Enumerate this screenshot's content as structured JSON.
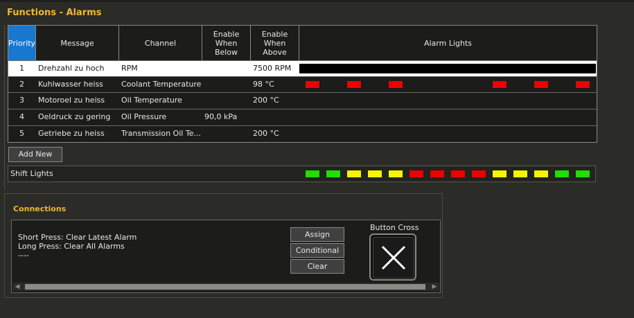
{
  "page_title": "Functions - Alarms",
  "table": {
    "headers": {
      "priority": "Priority",
      "message": "Message",
      "channel": "Channel",
      "below": "Enable When Below",
      "above": "Enable When Above",
      "lights": "Alarm Lights"
    },
    "rows": [
      {
        "priority": "1",
        "message": "Drehzahl zu hoch",
        "channel": "RPM",
        "below": "",
        "above": "7500 RPM",
        "selected": true
      },
      {
        "priority": "2",
        "message": "Kuhlwasser heiss",
        "channel": "Coolant Temperature",
        "below": "",
        "above": "98 °C",
        "lamps": [
          "red",
          "",
          "red",
          "",
          "red",
          "",
          "",
          "",
          "",
          "red",
          "",
          "red",
          "",
          "red"
        ]
      },
      {
        "priority": "3",
        "message": "Motoroel zu heiss",
        "channel": "Oil Temperature",
        "below": "",
        "above": "200 °C"
      },
      {
        "priority": "4",
        "message": "Oeldruck zu gering",
        "channel": "Oil Pressure",
        "below": "90,0 kPa",
        "above": ""
      },
      {
        "priority": "5",
        "message": "Getriebe zu heiss",
        "channel": "Transmission Oil Te...",
        "below": "",
        "above": "200 °C"
      }
    ]
  },
  "add_new_label": "Add New",
  "shift_lights": {
    "label": "Shift Lights",
    "colors": [
      "green",
      "green",
      "yellow",
      "yellow",
      "yellow",
      "red",
      "red",
      "red",
      "red",
      "yellow",
      "yellow",
      "yellow",
      "green",
      "green"
    ]
  },
  "connections": {
    "title": "Connections",
    "line1": "Short Press: Clear Latest Alarm",
    "line2": "Long Press: Clear All Alarms",
    "line3": "----",
    "assign_label": "Assign",
    "conditional_label": "Conditional",
    "clear_label": "Clear",
    "button_name": "Button Cross"
  },
  "colors": {
    "accent": "#f0b830",
    "selected_header": "#1878d0",
    "red": "#ee0000",
    "green": "#22dd00",
    "yellow": "#f5f500"
  }
}
